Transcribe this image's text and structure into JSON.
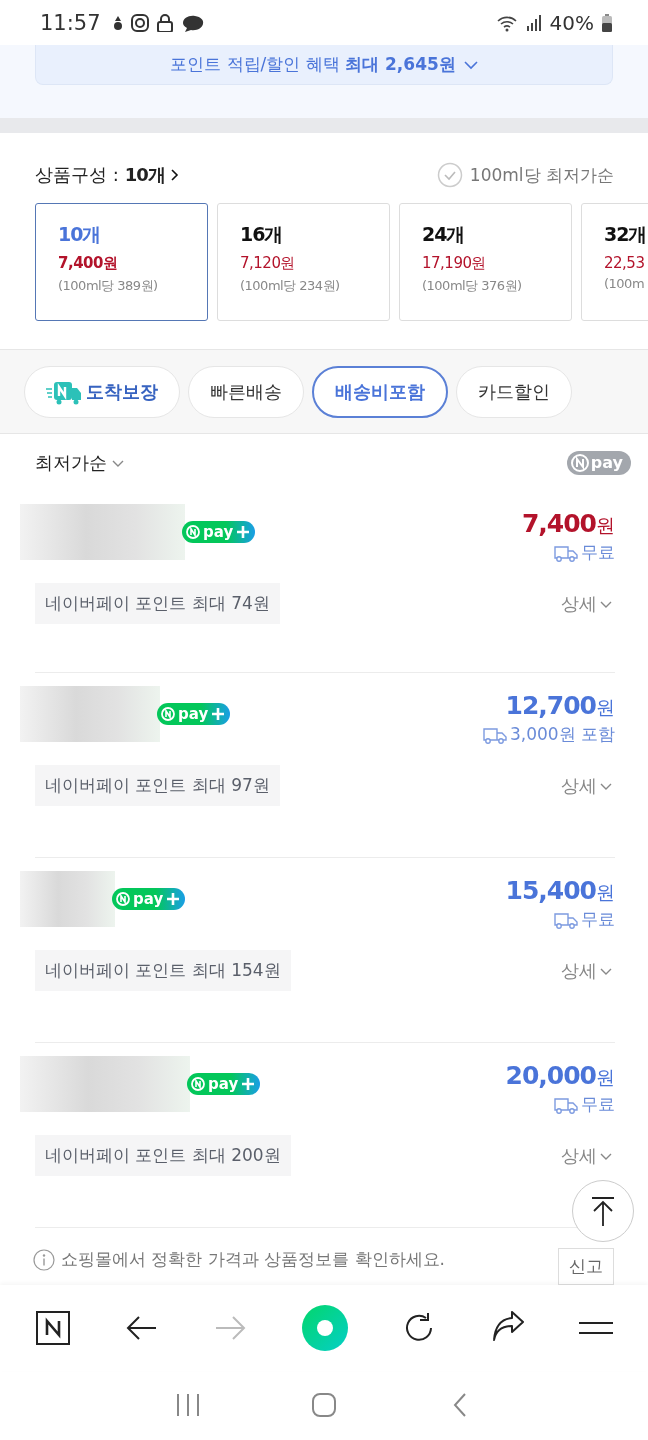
{
  "status_bar": {
    "time": "11:57",
    "battery": "40%"
  },
  "benefit_banner": {
    "text": "포인트 적립/할인 혜택 **최대 2,645원**"
  },
  "option_section": {
    "label": "상품구성 :",
    "value": "10개",
    "sort_check": {
      "label": "100ml당 최저가순",
      "checked": false
    },
    "options": [
      {
        "count": "10개",
        "price": "7,400원",
        "unit_price": "(100ml당 389원)",
        "selected": true
      },
      {
        "count": "16개",
        "price": "7,120원",
        "unit_price": "(100ml당 234원)",
        "selected": false
      },
      {
        "count": "24개",
        "price": "17,190원",
        "unit_price": "(100ml당 376원)",
        "selected": false
      },
      {
        "count": "32개",
        "price": "22,53",
        "unit_price": "(100m",
        "selected": false
      }
    ]
  },
  "filters": [
    {
      "label": "도착보장",
      "kind": "badge",
      "selected": false
    },
    {
      "label": "빠른배송",
      "kind": "plain",
      "selected": false
    },
    {
      "label": "배송비포함",
      "kind": "plain",
      "selected": true
    },
    {
      "label": "카드할인",
      "kind": "plain",
      "selected": false
    }
  ],
  "sort": {
    "label": "최저가순",
    "npay_label": "pay"
  },
  "offers": [
    {
      "badge": "pay",
      "price": "7,400",
      "unit": "원",
      "shipping": "무료",
      "points": "네이버페이 포인트 최대 74원",
      "detail": "상세",
      "lowest": true
    },
    {
      "badge": "pay",
      "price": "12,700",
      "unit": "원",
      "shipping": "3,000원 포함",
      "points": "네이버페이 포인트 최대 97원",
      "detail": "상세",
      "lowest": false
    },
    {
      "badge": "pay",
      "price": "15,400",
      "unit": "원",
      "shipping": "무료",
      "points": "네이버페이 포인트 최대 154원",
      "detail": "상세",
      "lowest": false
    },
    {
      "badge": "pay",
      "price": "20,000",
      "unit": "원",
      "shipping": "무료",
      "points": "네이버페이 포인트 최대 200원",
      "detail": "상세",
      "lowest": false
    }
  ],
  "notice": {
    "text": "쇼핑몰에서 정확한 가격과 상품정보를 확인하세요.",
    "report": "신고"
  }
}
